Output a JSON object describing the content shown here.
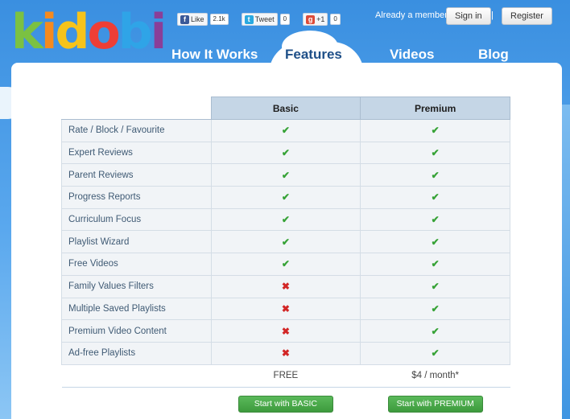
{
  "brand": {
    "letters": [
      "k",
      "i",
      "d",
      "o",
      "b",
      "i"
    ],
    "letter_colors": [
      "#7bc142",
      "#f58a1f",
      "#f6c31a",
      "#ee3e35",
      "#2fa4e7",
      "#8a3e98"
    ]
  },
  "social": [
    {
      "icon": "facebook-icon",
      "label": "Like",
      "count": "2.1k",
      "color": "#3b5998",
      "glyph": "f"
    },
    {
      "icon": "twitter-icon",
      "label": "Tweet",
      "count": "0",
      "color": "#2aa9e0",
      "glyph": "t"
    },
    {
      "icon": "google-plus-icon",
      "label": "+1",
      "count": "0",
      "color": "#dd4b39",
      "glyph": "g"
    }
  ],
  "header": {
    "member_text": "Already a member?",
    "sign_in": "Sign in",
    "separator": "|",
    "register": "Register"
  },
  "nav": [
    {
      "label": "How It Works",
      "active": false
    },
    {
      "label": "Features",
      "active": true
    },
    {
      "label": "Videos",
      "active": false
    },
    {
      "label": "Blog",
      "active": false
    }
  ],
  "table": {
    "columns": [
      "Basic",
      "Premium"
    ],
    "rows": [
      {
        "feature": "Rate / Block / Favourite",
        "basic": true,
        "premium": true
      },
      {
        "feature": "Expert Reviews",
        "basic": true,
        "premium": true
      },
      {
        "feature": "Parent Reviews",
        "basic": true,
        "premium": true
      },
      {
        "feature": "Progress Reports",
        "basic": true,
        "premium": true
      },
      {
        "feature": "Curriculum Focus",
        "basic": true,
        "premium": true
      },
      {
        "feature": "Playlist Wizard",
        "basic": true,
        "premium": true
      },
      {
        "feature": "Free Videos",
        "basic": true,
        "premium": true
      },
      {
        "feature": "Family Values Filters",
        "basic": false,
        "premium": true
      },
      {
        "feature": "Multiple Saved Playlists",
        "basic": false,
        "premium": true
      },
      {
        "feature": "Premium Video Content",
        "basic": false,
        "premium": true
      },
      {
        "feature": "Ad-free Playlists",
        "basic": false,
        "premium": true
      }
    ],
    "check_glyph": "✔",
    "cross_glyph": "✖",
    "prices": {
      "basic": "FREE",
      "premium": "$4 / month*"
    },
    "cta": {
      "basic": "Start with BASIC",
      "premium": "Start with PREMIUM"
    }
  }
}
